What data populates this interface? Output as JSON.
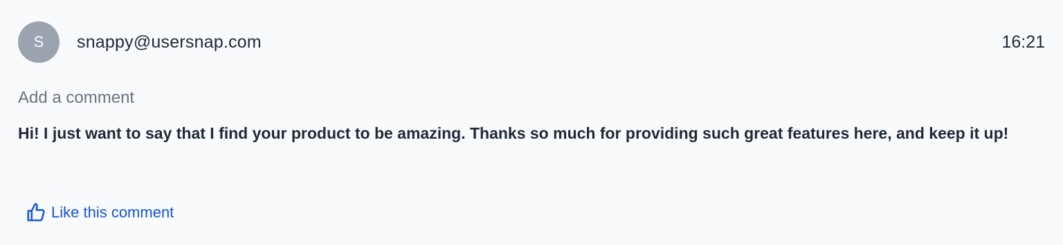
{
  "comment": {
    "avatar_initial": "S",
    "author": "snappy@usersnap.com",
    "time": "16:21",
    "label": "Add a comment",
    "text": "Hi! I just want to say that I find your product to be amazing. Thanks so much for providing such great features here, and keep it up!",
    "like_label": "Like this comment",
    "like_icon": "thumbs-up-icon"
  },
  "colors": {
    "background": "#f9fafc",
    "avatar": "#9aa3ae",
    "link": "#1554d8",
    "muted_text": "#6b7280",
    "text": "#1f2937"
  }
}
